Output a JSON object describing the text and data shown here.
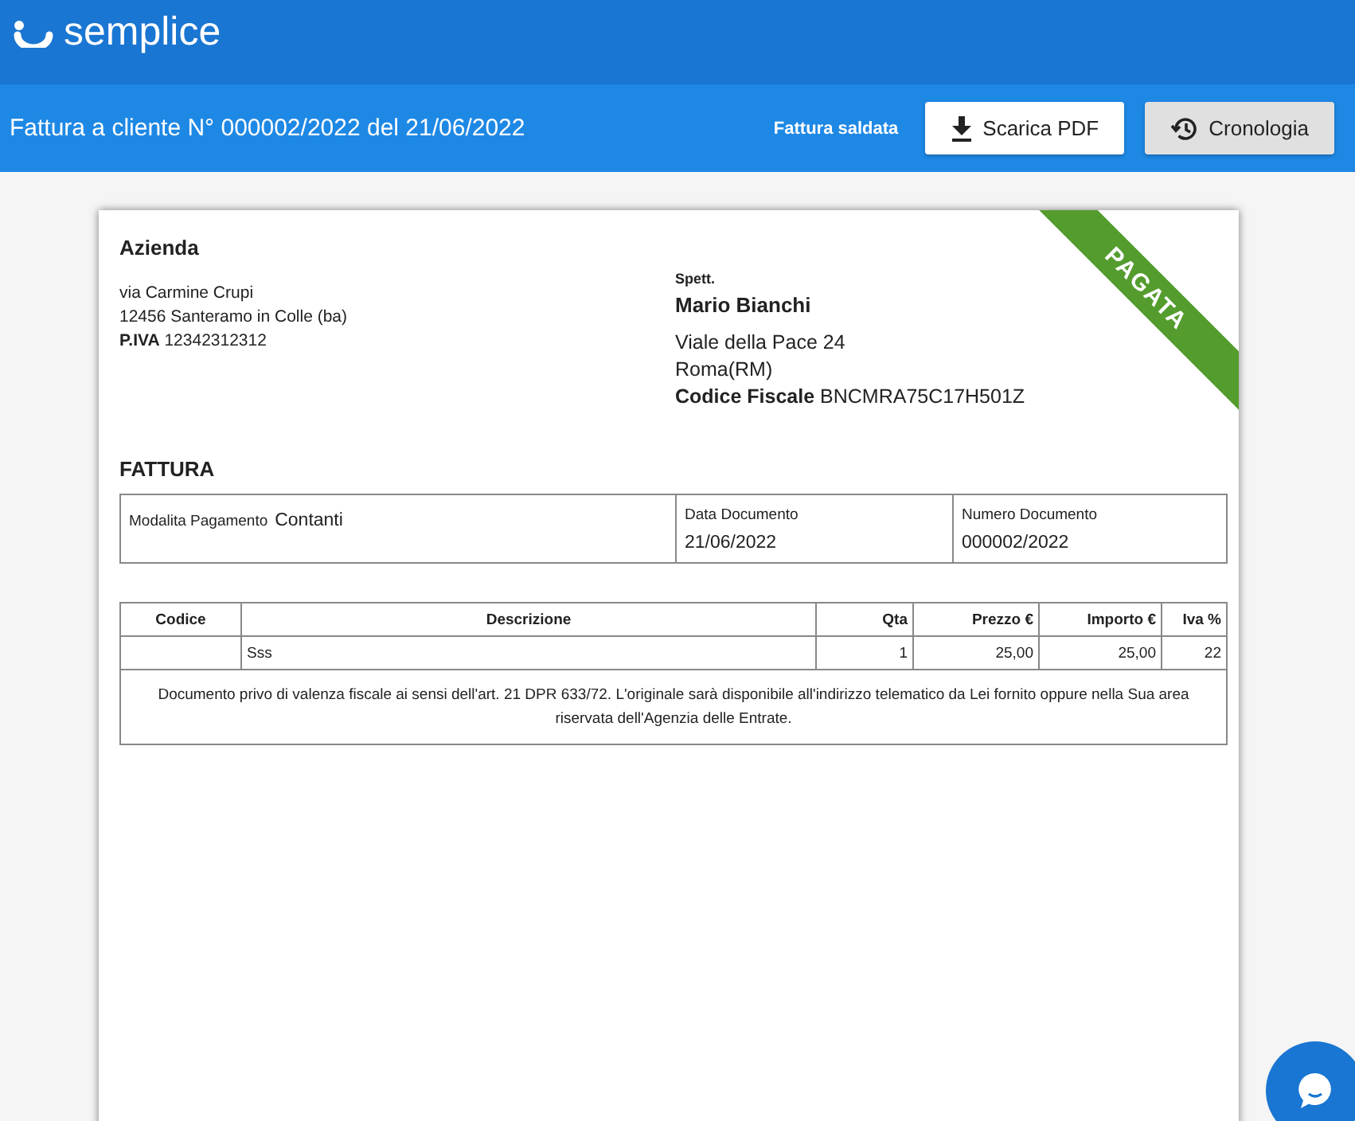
{
  "brand": {
    "name": "semplice"
  },
  "toolbar": {
    "title": "Fattura a cliente N° 000002/2022 del 21/06/2022",
    "status": "Fattura saldata",
    "buttons": [
      {
        "kind": "download",
        "label": "Scarica PDF"
      },
      {
        "kind": "history",
        "label": "Cronologia"
      }
    ]
  },
  "invoice": {
    "paid": true,
    "ribbon": "PAGATA",
    "seller": {
      "name": "Azienda",
      "lines": [
        "via Carmine Crupi",
        "12456 Santeramo in Colle (ba)",
        "**P.IVA** 12342312312"
      ]
    },
    "recipient": {
      "heading": "Spett.",
      "name": "Mario Bianchi",
      "lines": [
        "Viale della Pace 24",
        "Roma(RM)",
        "**Codice Fiscale** BNCMRA75C17H501Z"
      ]
    },
    "doc_title": "FATTURA",
    "info": {
      "payment_label": "Modalita Pagamento",
      "payment_value": "Contanti",
      "fields": [
        {
          "label": "Data Documento",
          "value": "21/06/2022"
        },
        {
          "label": "Numero Documento",
          "value": "000002/2022"
        }
      ]
    },
    "table": {
      "columns": [
        "Codice",
        "Descrizione",
        "Qta",
        "Prezzo €",
        "Importo €",
        "Iva %"
      ],
      "rows": [
        [
          "",
          "Sss",
          "1",
          "25,00",
          "25,00",
          "22"
        ]
      ],
      "note": "Documento privo di valenza fiscale ai sensi dell'art. 21 DPR 633/72. L'originale sarà disponibile all'indirizzo telematico da Lei fornito oppure nella Sua area riservata dell'Agenzia delle Entrate."
    }
  }
}
